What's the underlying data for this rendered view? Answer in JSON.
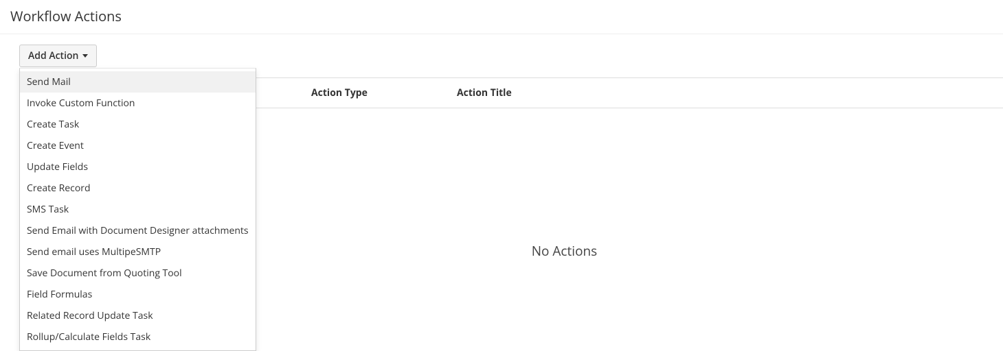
{
  "page": {
    "title": "Workflow Actions",
    "empty_message": "No Actions"
  },
  "toolbar": {
    "add_action_label": "Add Action"
  },
  "dropdown": {
    "items": [
      {
        "label": "Send Mail"
      },
      {
        "label": "Invoke Custom Function"
      },
      {
        "label": "Create Task"
      },
      {
        "label": "Create Event"
      },
      {
        "label": "Update Fields"
      },
      {
        "label": "Create Record"
      },
      {
        "label": "SMS Task"
      },
      {
        "label": "Send Email with Document Designer attachments"
      },
      {
        "label": "Send email uses MultipeSMTP"
      },
      {
        "label": "Save Document from Quoting Tool"
      },
      {
        "label": "Field Formulas"
      },
      {
        "label": "Related Record Update Task"
      },
      {
        "label": "Rollup/Calculate Fields Task"
      }
    ]
  },
  "table": {
    "columns": {
      "type": "Action Type",
      "title": "Action Title"
    }
  }
}
